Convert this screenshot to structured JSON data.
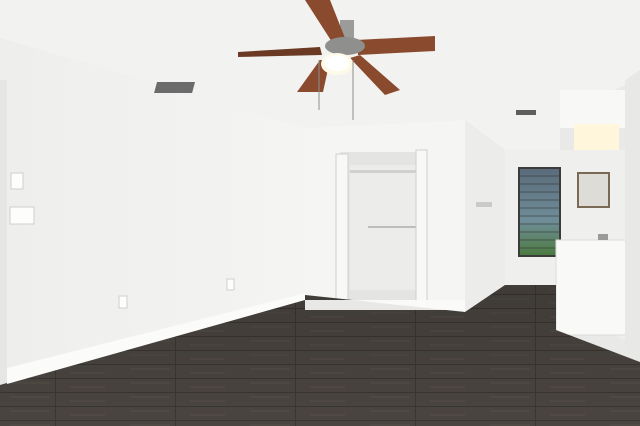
{
  "scene": {
    "subject": "empty-room-interior",
    "colors": {
      "ceiling": "#f2f2f0",
      "left_wall": "#f1f1ef",
      "center_wall": "#f5f5f3",
      "right_wall": "#ececea",
      "floor": "#4a4540",
      "fan_blade": "#8a4a2e",
      "baseboard": "#fbfbfa"
    },
    "icons": [
      "ceiling-fan-icon",
      "light-bulb-icon",
      "window-icon",
      "mirror-icon",
      "outlet-icon",
      "light-switch-icon",
      "vent-icon",
      "faucet-icon"
    ]
  }
}
